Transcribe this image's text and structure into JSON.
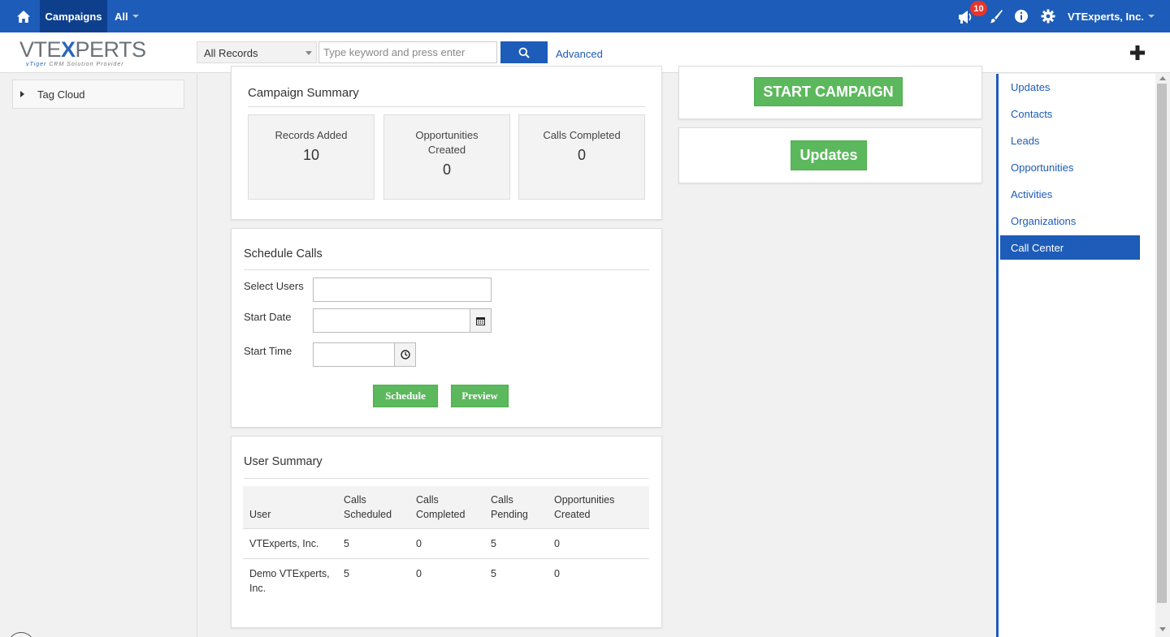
{
  "topbar": {
    "home_icon": "home-icon",
    "module_tab": "Campaigns",
    "filter_menu": "All",
    "notification_count": "10",
    "user_name": "VTExperts, Inc.",
    "icons": [
      "megaphone-icon",
      "brush-icon",
      "info-icon",
      "gear-icon"
    ]
  },
  "subbar": {
    "logo_main_left": "VTE",
    "logo_main_x": "X",
    "logo_main_right": "PERTS",
    "logo_sub_brand": "vTiger",
    "logo_sub_rest": "CRM Solution Provider",
    "record_select": "All Records",
    "search_placeholder": "Type keyword and press enter",
    "advanced_label": "Advanced"
  },
  "sidebar": {
    "tag_cloud": "Tag Cloud"
  },
  "campaign_summary": {
    "title": "Campaign Summary",
    "stats": [
      {
        "label": "Records Added",
        "value": "10"
      },
      {
        "label": "Opportunities Created",
        "value": "0"
      },
      {
        "label": "Calls Completed",
        "value": "0"
      }
    ]
  },
  "schedule_calls": {
    "title": "Schedule Calls",
    "select_users_label": "Select Users",
    "start_date_label": "Start Date",
    "start_time_label": "Start Time",
    "schedule_button": "Schedule",
    "preview_button": "Preview"
  },
  "user_summary": {
    "title": "User Summary",
    "columns": [
      "User",
      "Calls Scheduled",
      "Calls Completed",
      "Calls Pending",
      "Opportunities Created"
    ],
    "rows": [
      [
        "VTExperts, Inc.",
        "5",
        "0",
        "5",
        "0"
      ],
      [
        "Demo VTExperts, Inc.",
        "5",
        "0",
        "5",
        "0"
      ]
    ]
  },
  "actions": {
    "start_campaign": "START CAMPAIGN",
    "updates": "Updates"
  },
  "right_nav": {
    "items": [
      "Updates",
      "Contacts",
      "Leads",
      "Opportunities",
      "Activities",
      "Organizations",
      "Call Center"
    ],
    "active": "Call Center"
  },
  "colors": {
    "brand_blue": "#1d5cb8",
    "dark_blue": "#0d3f8d",
    "green": "#5cb85c",
    "badge_red": "#e8342b"
  }
}
